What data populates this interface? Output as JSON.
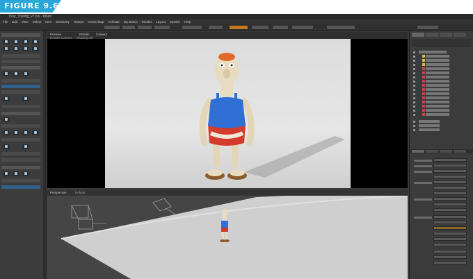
{
  "figure": {
    "label": "FIGURE 9.6"
  },
  "window": {
    "title": "Tony_Toonfig_v7.lxo - Modo"
  },
  "menu": [
    "File",
    "Edit",
    "View",
    "Select",
    "Item",
    "Geometry",
    "Texture",
    "Vertex Map",
    "Animate",
    "Dynamics",
    "Render",
    "Layout",
    "System",
    "Help"
  ],
  "left_panel": {
    "sections": [
      "Basic",
      "Polygon",
      "Curves",
      "Mesh Edit"
    ],
    "labels": [
      "Deform",
      "Duplicate",
      "Edge",
      "Sculpt",
      "Rig"
    ]
  },
  "viewport_top": {
    "tabs": [
      "Preview",
      "Render",
      "Camera"
    ],
    "subtabs": [
      "Render Camera",
      "Shading Off"
    ]
  },
  "viewport_bottom": {
    "tab": "Perspective",
    "shade": "Default"
  },
  "right_panel": {
    "tabs": [
      "Items",
      "Shading",
      "Channels",
      "Groups"
    ],
    "props_tabs": [
      "Properties",
      "Channels",
      "Display",
      "Tags"
    ],
    "props_labels": [
      "Position",
      "Rotation",
      "Scale",
      "Order"
    ]
  },
  "colors": {
    "accent": "#2aa7d8",
    "shirt": "#2f6fd6",
    "shorts": "#d33b2c",
    "skin": "#e8dcc0",
    "hair": "#e06a2a"
  }
}
